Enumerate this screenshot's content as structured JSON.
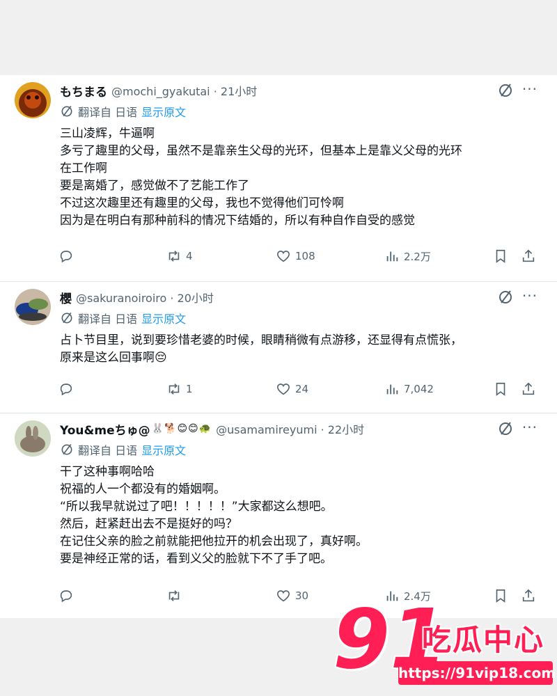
{
  "posts": [
    {
      "name": "もちまる",
      "name_emoji": "",
      "handle": "@mochi_gyakutai · 21小时",
      "translate_label": "翻译自 日语",
      "show_original": "显示原文",
      "lines": [
        "三山凌辉，牛逼啊",
        "多亏了趣里的父母，虽然不是靠亲生父母的光环，但基本上是靠义父母的光环",
        "在工作啊",
        "要是离婚了，感觉做不了艺能工作了",
        "不过这次趣里还有趣里的父母，我也不觉得他们可怜啊",
        "因为是在明白有那种前科的情况下结婚的，所以有种自作自受的感觉"
      ],
      "replies": "",
      "retweets": "4",
      "likes": "108",
      "views": "2.2万"
    },
    {
      "name": "櫻",
      "name_emoji": "",
      "handle": "@sakuranoiroiro · 20小时",
      "translate_label": "翻译自 日语",
      "show_original": "显示原文",
      "lines": [
        "占卜节目里，说到要珍惜老婆的时候，眼睛稍微有点游移，还显得有点慌张，",
        "原来是这么回事啊😔"
      ],
      "replies": "",
      "retweets": "1",
      "likes": "24",
      "views": "7,042"
    },
    {
      "name": "You&meちゅ@",
      "name_emoji": "🐰🐕😊😊🐢",
      "handle": "@usamamireyumi · 22小时",
      "translate_label": "翻译自 日语",
      "show_original": "显示原文",
      "lines": [
        "干了这种事啊哈哈",
        "祝福的人一个都没有的婚姻啊。",
        "“所以我早就说过了吧！！！！！”大家都这么想吧。",
        "然后，赶紧赶出去不是挺好的吗？",
        "在记住父亲的脸之前就能把他拉开的机会出现了，真好啊。",
        "要是神经正常的话，看到义父的脸就下不了手了吧。"
      ],
      "replies": "",
      "retweets": "",
      "likes": "30",
      "views": "2.4万"
    }
  ],
  "watermark": {
    "number": "91",
    "brand": "吃瓜中心",
    "url": "https://91vip18.com"
  },
  "colors": {
    "text": "#0f1419",
    "secondary": "#536471",
    "link": "#1d9bf0",
    "watermark": "#ff1f54"
  }
}
